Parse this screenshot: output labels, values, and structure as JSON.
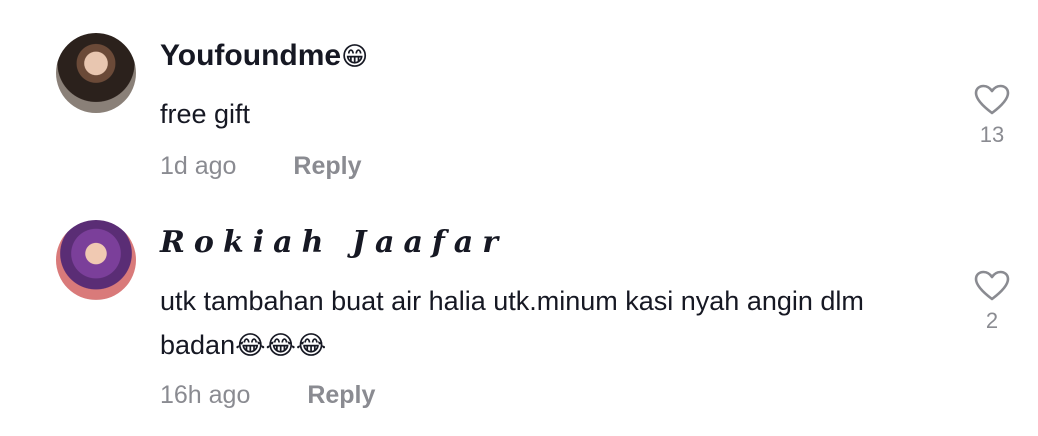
{
  "comments": [
    {
      "username": "Youfoundme",
      "username_emoji": "😁",
      "text": "free gift",
      "time": "1d ago",
      "reply_label": "Reply",
      "likes": "13"
    },
    {
      "username": "Rokiah Jaafar",
      "text": "utk tambahan buat air halia utk.minum kasi nyah angin dlm badan",
      "text_emoji": "😂😂😂",
      "time": "16h ago",
      "reply_label": "Reply",
      "likes": "2"
    }
  ],
  "icons": {
    "like": "heart-outline-icon"
  },
  "colors": {
    "text": "#161823",
    "secondary": "#8a8b91"
  }
}
